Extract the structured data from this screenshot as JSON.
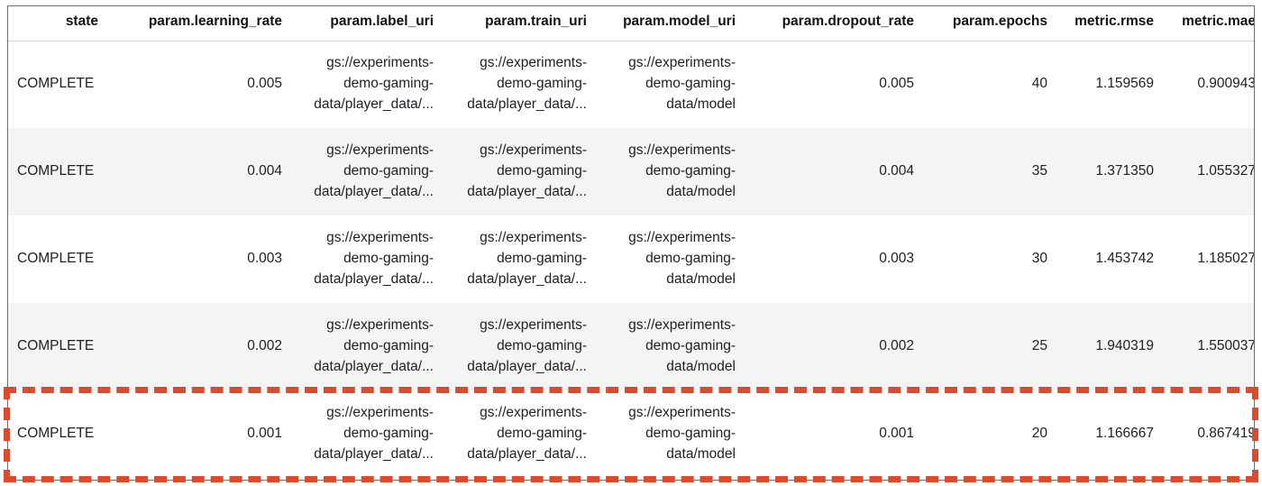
{
  "table": {
    "columns": [
      {
        "key": "state",
        "label": "state"
      },
      {
        "key": "learning_rate",
        "label": "param.learning_rate"
      },
      {
        "key": "label_uri",
        "label": "param.label_uri"
      },
      {
        "key": "train_uri",
        "label": "param.train_uri"
      },
      {
        "key": "model_uri",
        "label": "param.model_uri"
      },
      {
        "key": "dropout_rate",
        "label": "param.dropout_rate"
      },
      {
        "key": "epochs",
        "label": "param.epochs"
      },
      {
        "key": "rmse",
        "label": "metric.rmse"
      },
      {
        "key": "mae",
        "label": "metric.mae"
      }
    ],
    "rows": [
      {
        "state": "COMPLETE",
        "learning_rate": "0.005",
        "label_uri": "gs://experiments-demo-gaming-data/player_data/...",
        "train_uri": "gs://experiments-demo-gaming-data/player_data/...",
        "model_uri": "gs://experiments-demo-gaming-data/model",
        "dropout_rate": "0.005",
        "epochs": "40",
        "rmse": "1.159569",
        "mae": "0.900943",
        "shaded": false,
        "highlighted": false
      },
      {
        "state": "COMPLETE",
        "learning_rate": "0.004",
        "label_uri": "gs://experiments-demo-gaming-data/player_data/...",
        "train_uri": "gs://experiments-demo-gaming-data/player_data/...",
        "model_uri": "gs://experiments-demo-gaming-data/model",
        "dropout_rate": "0.004",
        "epochs": "35",
        "rmse": "1.371350",
        "mae": "1.055327",
        "shaded": true,
        "highlighted": false
      },
      {
        "state": "COMPLETE",
        "learning_rate": "0.003",
        "label_uri": "gs://experiments-demo-gaming-data/player_data/...",
        "train_uri": "gs://experiments-demo-gaming-data/player_data/...",
        "model_uri": "gs://experiments-demo-gaming-data/model",
        "dropout_rate": "0.003",
        "epochs": "30",
        "rmse": "1.453742",
        "mae": "1.185027",
        "shaded": false,
        "highlighted": false
      },
      {
        "state": "COMPLETE",
        "learning_rate": "0.002",
        "label_uri": "gs://experiments-demo-gaming-data/player_data/...",
        "train_uri": "gs://experiments-demo-gaming-data/player_data/...",
        "model_uri": "gs://experiments-demo-gaming-data/model",
        "dropout_rate": "0.002",
        "epochs": "25",
        "rmse": "1.940319",
        "mae": "1.550037",
        "shaded": true,
        "highlighted": false
      },
      {
        "state": "COMPLETE",
        "learning_rate": "0.001",
        "label_uri": "gs://experiments-demo-gaming-data/player_data/...",
        "train_uri": "gs://experiments-demo-gaming-data/player_data/...",
        "model_uri": "gs://experiments-demo-gaming-data/model",
        "dropout_rate": "0.001",
        "epochs": "20",
        "rmse": "1.166667",
        "mae": "0.867419",
        "shaded": false,
        "highlighted": true
      }
    ]
  },
  "annotation": {
    "highlight_color": "#dd4a2d",
    "highlight_style": "dashed",
    "target_row_index": 4
  },
  "colors": {
    "row_shaded": "#f4f4f4",
    "row_plain": "#ffffff",
    "text": "#202124",
    "header_text": "#131313",
    "table_border": "#6f6f6f",
    "header_divider": "#dcdcdc"
  }
}
